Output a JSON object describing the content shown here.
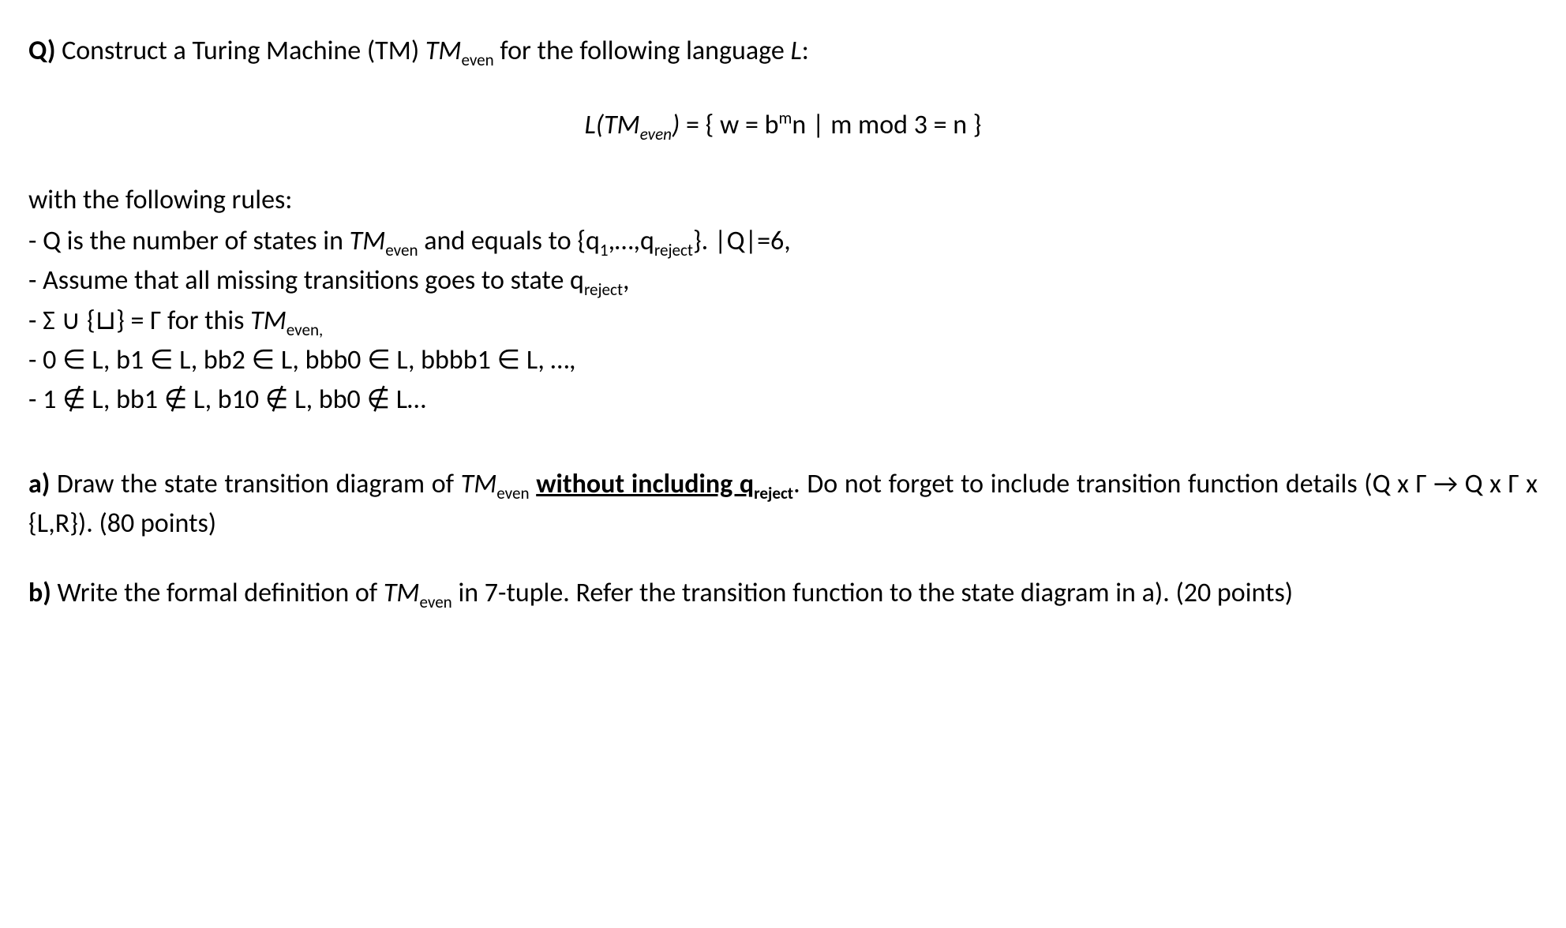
{
  "intro": {
    "q_prefix": "Q)",
    "before_tm": " Construct a Turing Machine (TM) ",
    "tm_abbrev": "TM",
    "tm_sub": "even",
    "after_tm": " for the following language ",
    "L_italic": "L",
    "colon": ":"
  },
  "formula": {
    "L_open": "L(TM",
    "L_sub": "even",
    "L_close": ")",
    "eq_open": " = { w = b",
    "sup_m": "m",
    "after_bm": "n | m mod 3 = n }"
  },
  "rules_intro": "with the following rules:",
  "rules": {
    "r1_a": "- Q is the number of states in ",
    "r1_tm": "TM",
    "r1_sub": "even",
    "r1_b": " and equals to {q",
    "r1_sub1": "1",
    "r1_c": ",…,q",
    "r1_sub_rej": "reject",
    "r1_d": "}. |Q|=6,",
    "r2_a": "- Assume that all missing transitions goes to state q",
    "r2_sub": "reject",
    "r2_b": ",",
    "r3_a": "- Σ ∪ {⊔} = Γ for this ",
    "r3_tm": "TM",
    "r3_sub": "even,",
    "r4": "- 0 ∈ L, b1 ∈ L, bb2 ∈ L, bbb0 ∈ L, bbbb1 ∈ L, …,",
    "r5": "- 1 ∉ L, bb1 ∉ L, b10 ∉ L, bb0 ∉ L…"
  },
  "part_a": {
    "label": "a)",
    "t1": " Draw the state transition diagram of ",
    "tm": "TM",
    "tm_sub": "even",
    "space": " ",
    "without_prefix": "without including q",
    "without_sub": "reject",
    "period": ".",
    "t2": " Do not forget to include transition function details (Q x Γ → Q x Γ x {L,R}). (80 points)"
  },
  "part_b": {
    "label": "b)",
    "t1": " Write the formal definition of ",
    "tm": "TM",
    "tm_sub": "even",
    "t2": " in 7-tuple. Refer the transition function to the state diagram in a). (20 points)"
  }
}
